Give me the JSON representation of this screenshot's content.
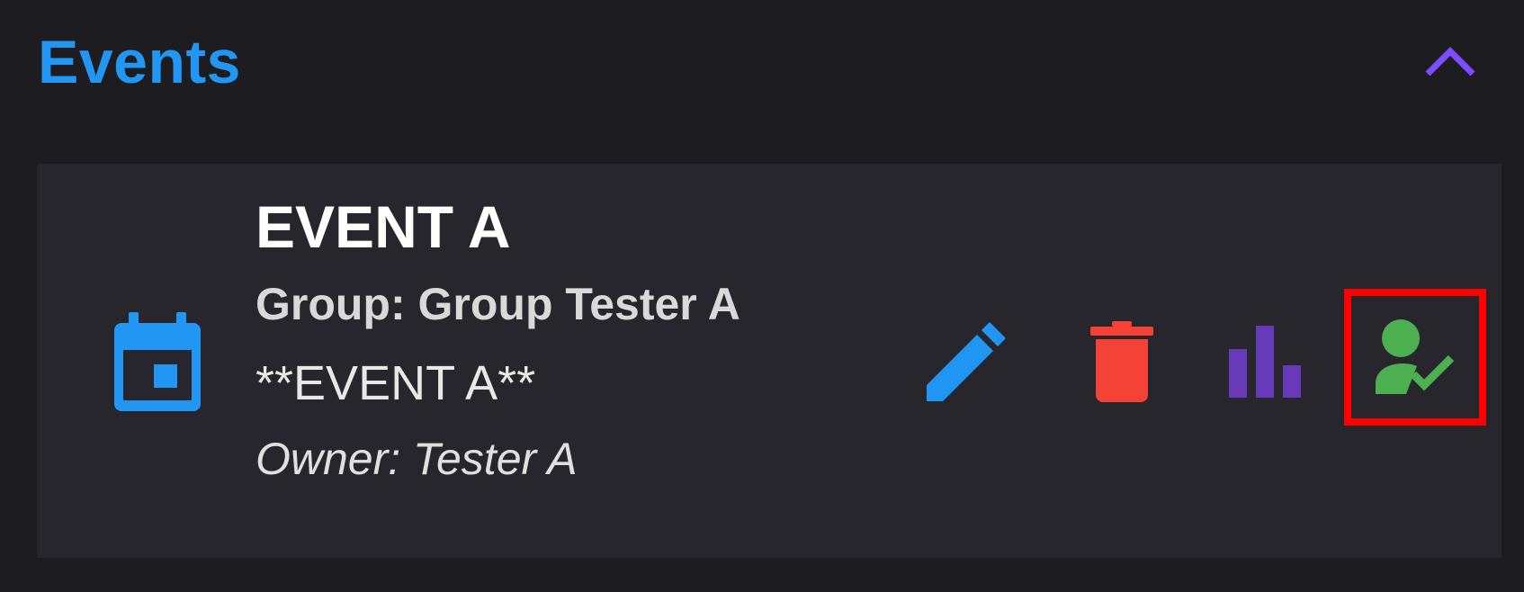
{
  "section": {
    "title": "Events"
  },
  "event": {
    "name": "EVENT A",
    "group": "Group: Group Tester A",
    "description": "**EVENT A**",
    "owner": "Owner: Tester A"
  },
  "icons": {
    "collapse": "chevron-up-icon",
    "event": "calendar-icon",
    "edit": "pencil-icon",
    "delete": "trash-icon",
    "stats": "bar-chart-icon",
    "attendance": "person-check-icon"
  },
  "colors": {
    "background": "#1c1c21",
    "card": "#26262c",
    "title": "#2196f3",
    "collapse": "#7c4dff",
    "calendar": "#2196f3",
    "edit": "#2196f3",
    "delete": "#f44336",
    "stats": "#673ab7",
    "attendance": "#4caf50",
    "highlight": "#ff0000"
  }
}
